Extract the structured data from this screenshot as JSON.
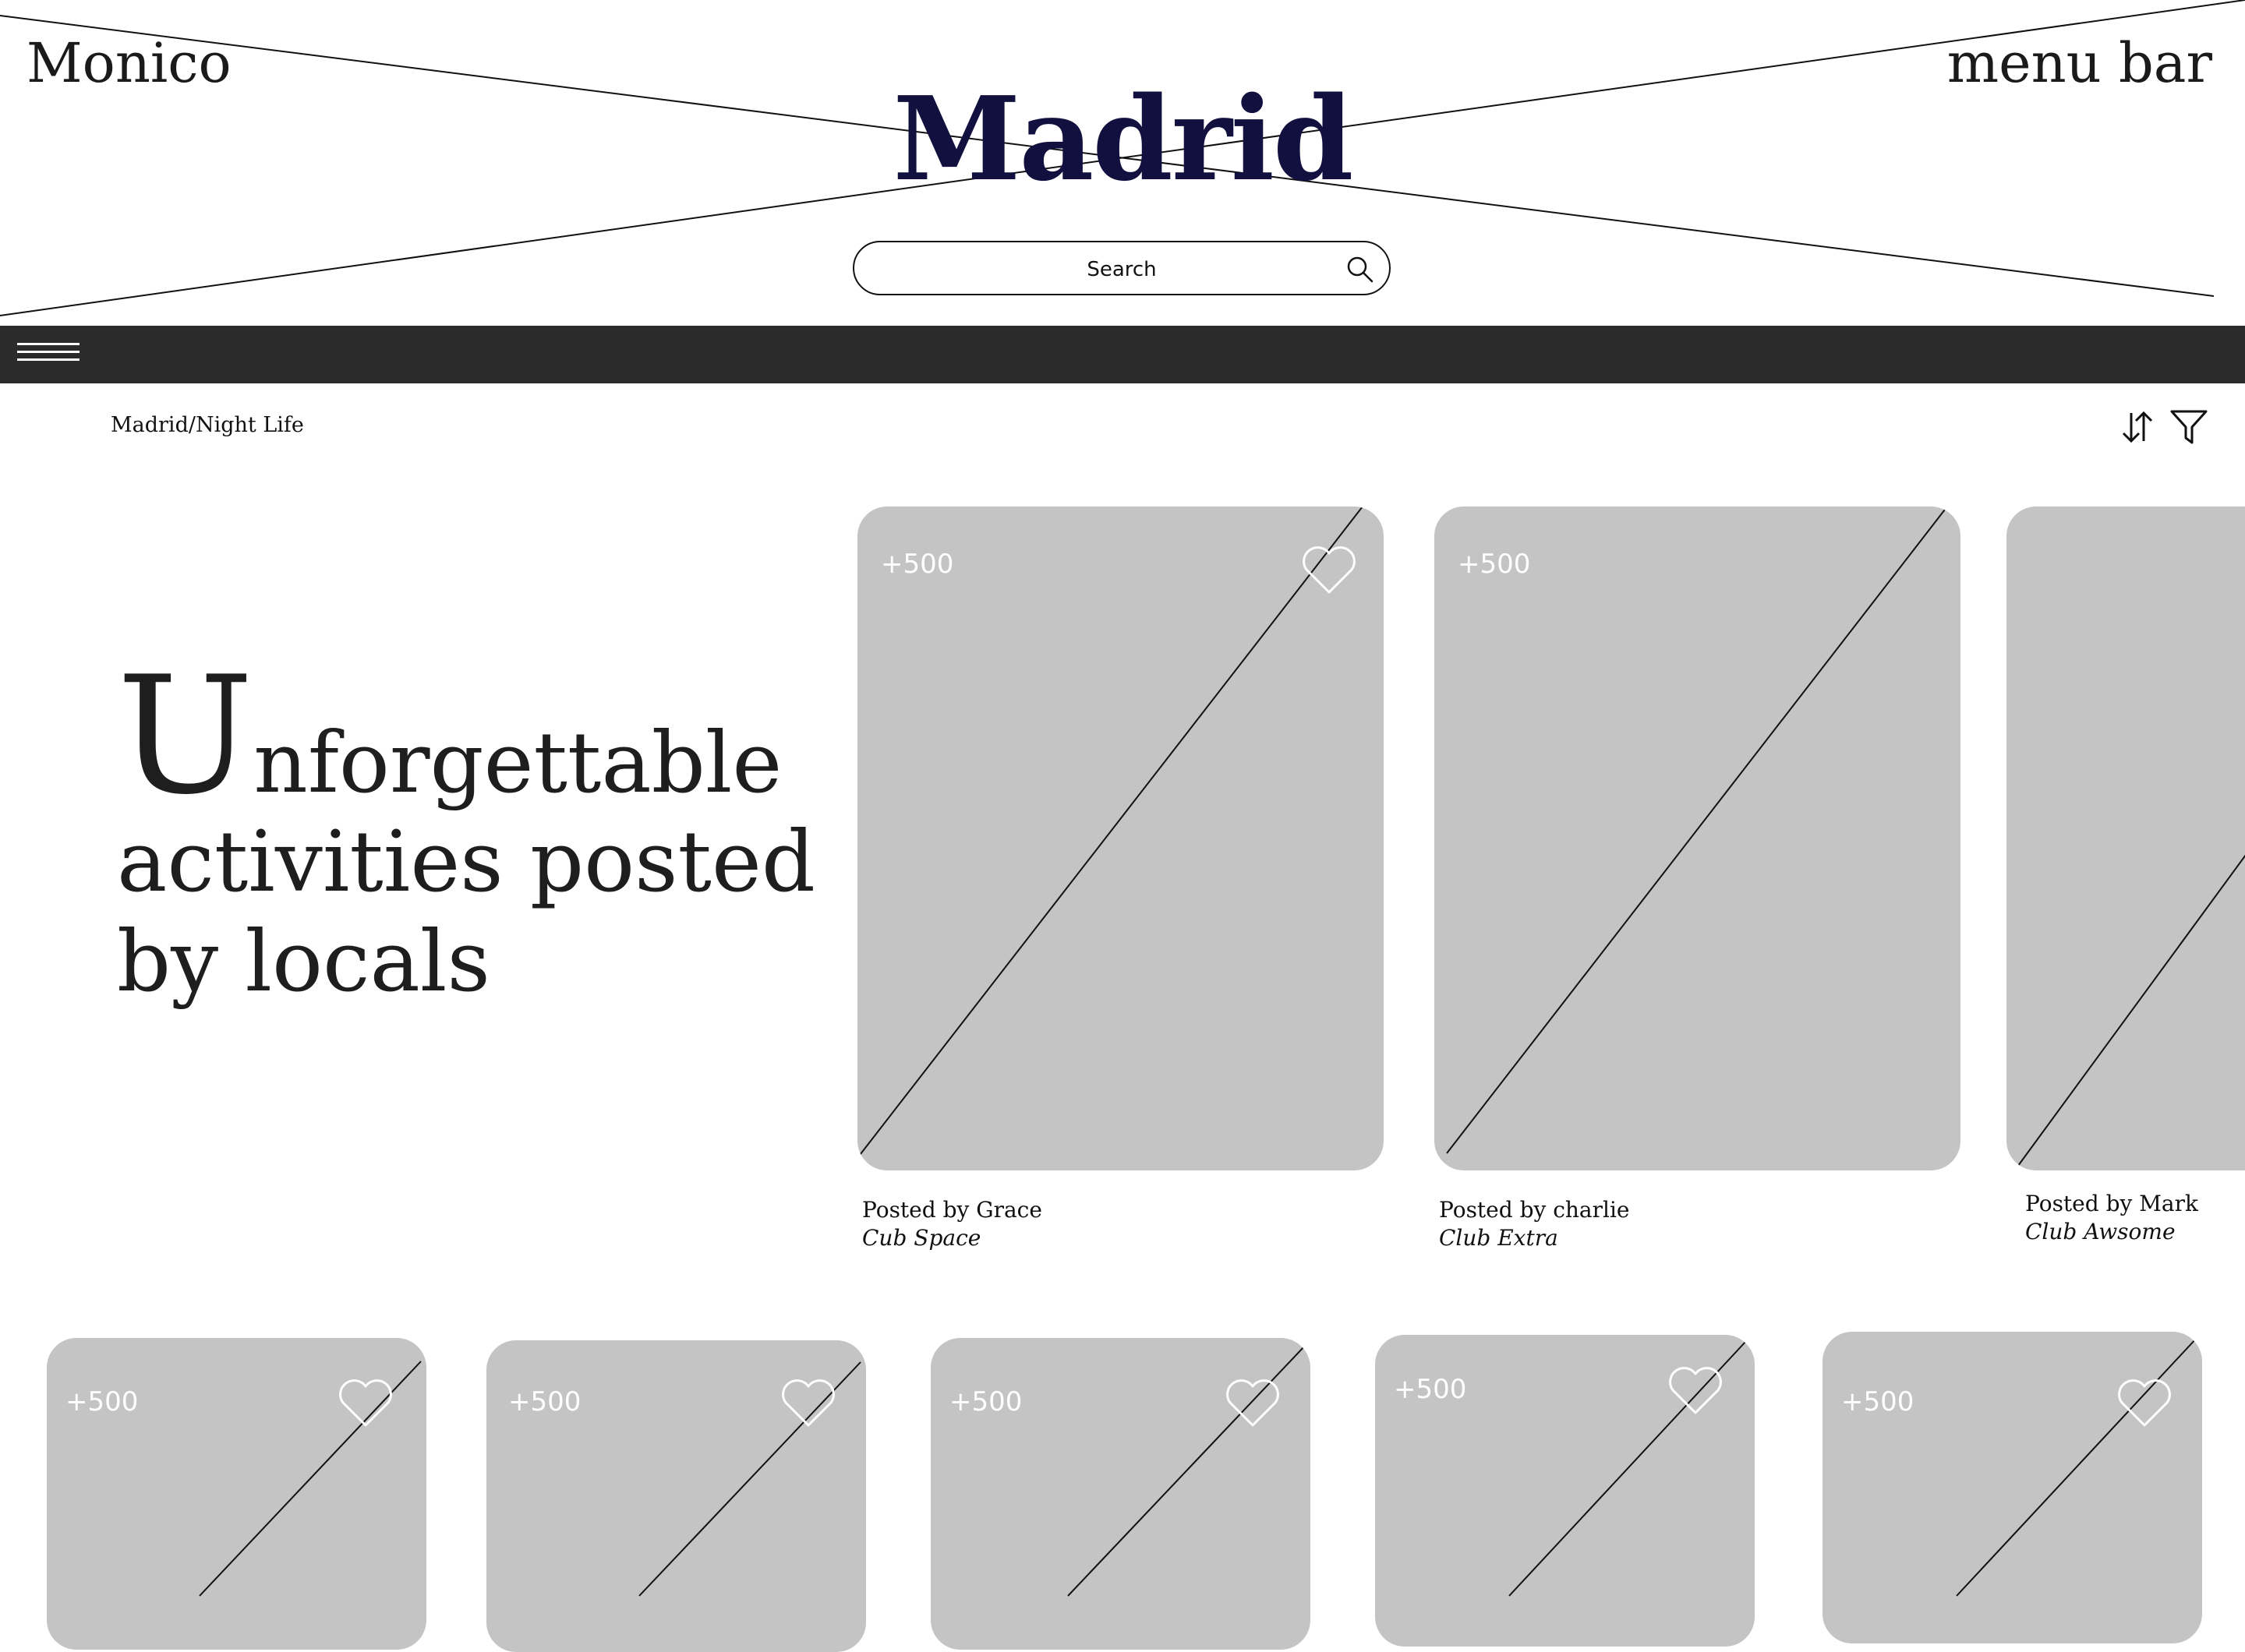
{
  "header": {
    "brand_left": "Monico",
    "brand_right": "menu bar",
    "title": "Madrid",
    "search": {
      "placeholder": "Search"
    }
  },
  "breadcrumb": "Madrid/Night Life",
  "hero": {
    "drop_cap": "U",
    "line1_rest": "nforgettable",
    "line2": "activities posted",
    "line3": "by locals"
  },
  "featured_cards": [
    {
      "count": "+500",
      "posted_by": "Posted by Grace",
      "place": "Cub Space",
      "favorite": true
    },
    {
      "count": "+500",
      "posted_by": "Posted by charlie",
      "place": "Club Extra",
      "favorite": false
    },
    {
      "count": "",
      "posted_by": "Posted by Mark",
      "place": "Club Awsome",
      "favorite": false
    }
  ],
  "grid_cards": [
    {
      "count": "+500",
      "favorite": true
    },
    {
      "count": "+500",
      "favorite": true
    },
    {
      "count": "+500",
      "favorite": true
    },
    {
      "count": "+500",
      "favorite": true
    },
    {
      "count": "+500",
      "favorite": true
    }
  ],
  "colors": {
    "title": "#12103f",
    "navbar": "#2b2b2b",
    "card_placeholder": "#c4c4c4"
  },
  "icons": [
    "search-icon",
    "hamburger-menu-icon",
    "sort-icon",
    "filter-icon",
    "heart-icon"
  ]
}
